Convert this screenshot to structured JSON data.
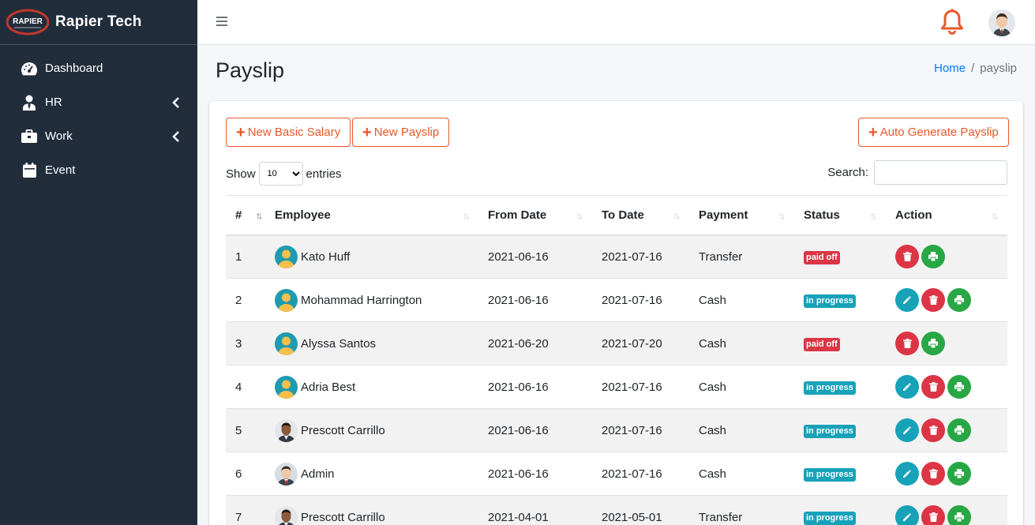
{
  "app": {
    "brand_name": "Rapier Tech",
    "logo_text": "RAPIER"
  },
  "sidebar": {
    "items": [
      {
        "label": "Dashboard",
        "icon": "tachometer-icon",
        "has_submenu": false
      },
      {
        "label": "HR",
        "icon": "user-tie-icon",
        "has_submenu": true
      },
      {
        "label": "Work",
        "icon": "briefcase-icon",
        "has_submenu": true
      },
      {
        "label": "Event",
        "icon": "calendar-icon",
        "has_submenu": false
      }
    ]
  },
  "header": {
    "page_title": "Payslip",
    "breadcrumb": {
      "home": "Home",
      "separator": "/",
      "current": "payslip"
    }
  },
  "toolbar": {
    "new_basic_salary": "New Basic Salary",
    "new_payslip": "New Payslip",
    "auto_generate": "Auto Generate Payslip"
  },
  "table_controls": {
    "show_label": "Show",
    "entries_value": "10",
    "entries_label": "entries",
    "search_label": "Search:",
    "search_value": ""
  },
  "table": {
    "columns": [
      "#",
      "Employee",
      "From Date",
      "To Date",
      "Payment",
      "Status",
      "Action"
    ],
    "rows": [
      {
        "num": "1",
        "employee": "Kato Huff",
        "avatar": "default",
        "from": "2021-06-16",
        "to": "2021-07-16",
        "payment": "Transfer",
        "status": "paid off",
        "status_type": "paid",
        "actions": [
          "delete",
          "print"
        ]
      },
      {
        "num": "2",
        "employee": "Mohammad Harrington",
        "avatar": "default",
        "from": "2021-06-16",
        "to": "2021-07-16",
        "payment": "Cash",
        "status": "in progress",
        "status_type": "prog",
        "actions": [
          "edit",
          "delete",
          "print"
        ]
      },
      {
        "num": "3",
        "employee": "Alyssa Santos",
        "avatar": "default",
        "from": "2021-06-20",
        "to": "2021-07-20",
        "payment": "Cash",
        "status": "paid off",
        "status_type": "paid",
        "actions": [
          "delete",
          "print"
        ]
      },
      {
        "num": "4",
        "employee": "Adria Best",
        "avatar": "default",
        "from": "2021-06-16",
        "to": "2021-07-16",
        "payment": "Cash",
        "status": "in progress",
        "status_type": "prog",
        "actions": [
          "edit",
          "delete",
          "print"
        ]
      },
      {
        "num": "5",
        "employee": "Prescott Carrillo",
        "avatar": "photo-dark",
        "from": "2021-06-16",
        "to": "2021-07-16",
        "payment": "Cash",
        "status": "in progress",
        "status_type": "prog",
        "actions": [
          "edit",
          "delete",
          "print"
        ]
      },
      {
        "num": "6",
        "employee": "Admin",
        "avatar": "photo-light",
        "from": "2021-06-16",
        "to": "2021-07-16",
        "payment": "Cash",
        "status": "in progress",
        "status_type": "prog",
        "actions": [
          "edit",
          "delete",
          "print"
        ]
      },
      {
        "num": "7",
        "employee": "Prescott Carrillo",
        "avatar": "photo-dark",
        "from": "2021-04-01",
        "to": "2021-05-01",
        "payment": "Transfer",
        "status": "in progress",
        "status_type": "prog",
        "actions": [
          "edit",
          "delete",
          "print"
        ]
      }
    ]
  },
  "colors": {
    "sidebar_bg": "#222d3c",
    "accent_orange": "#e8582a",
    "link_blue": "#007bff",
    "danger": "#dc3545",
    "info": "#17a2b8",
    "success": "#28a745"
  }
}
